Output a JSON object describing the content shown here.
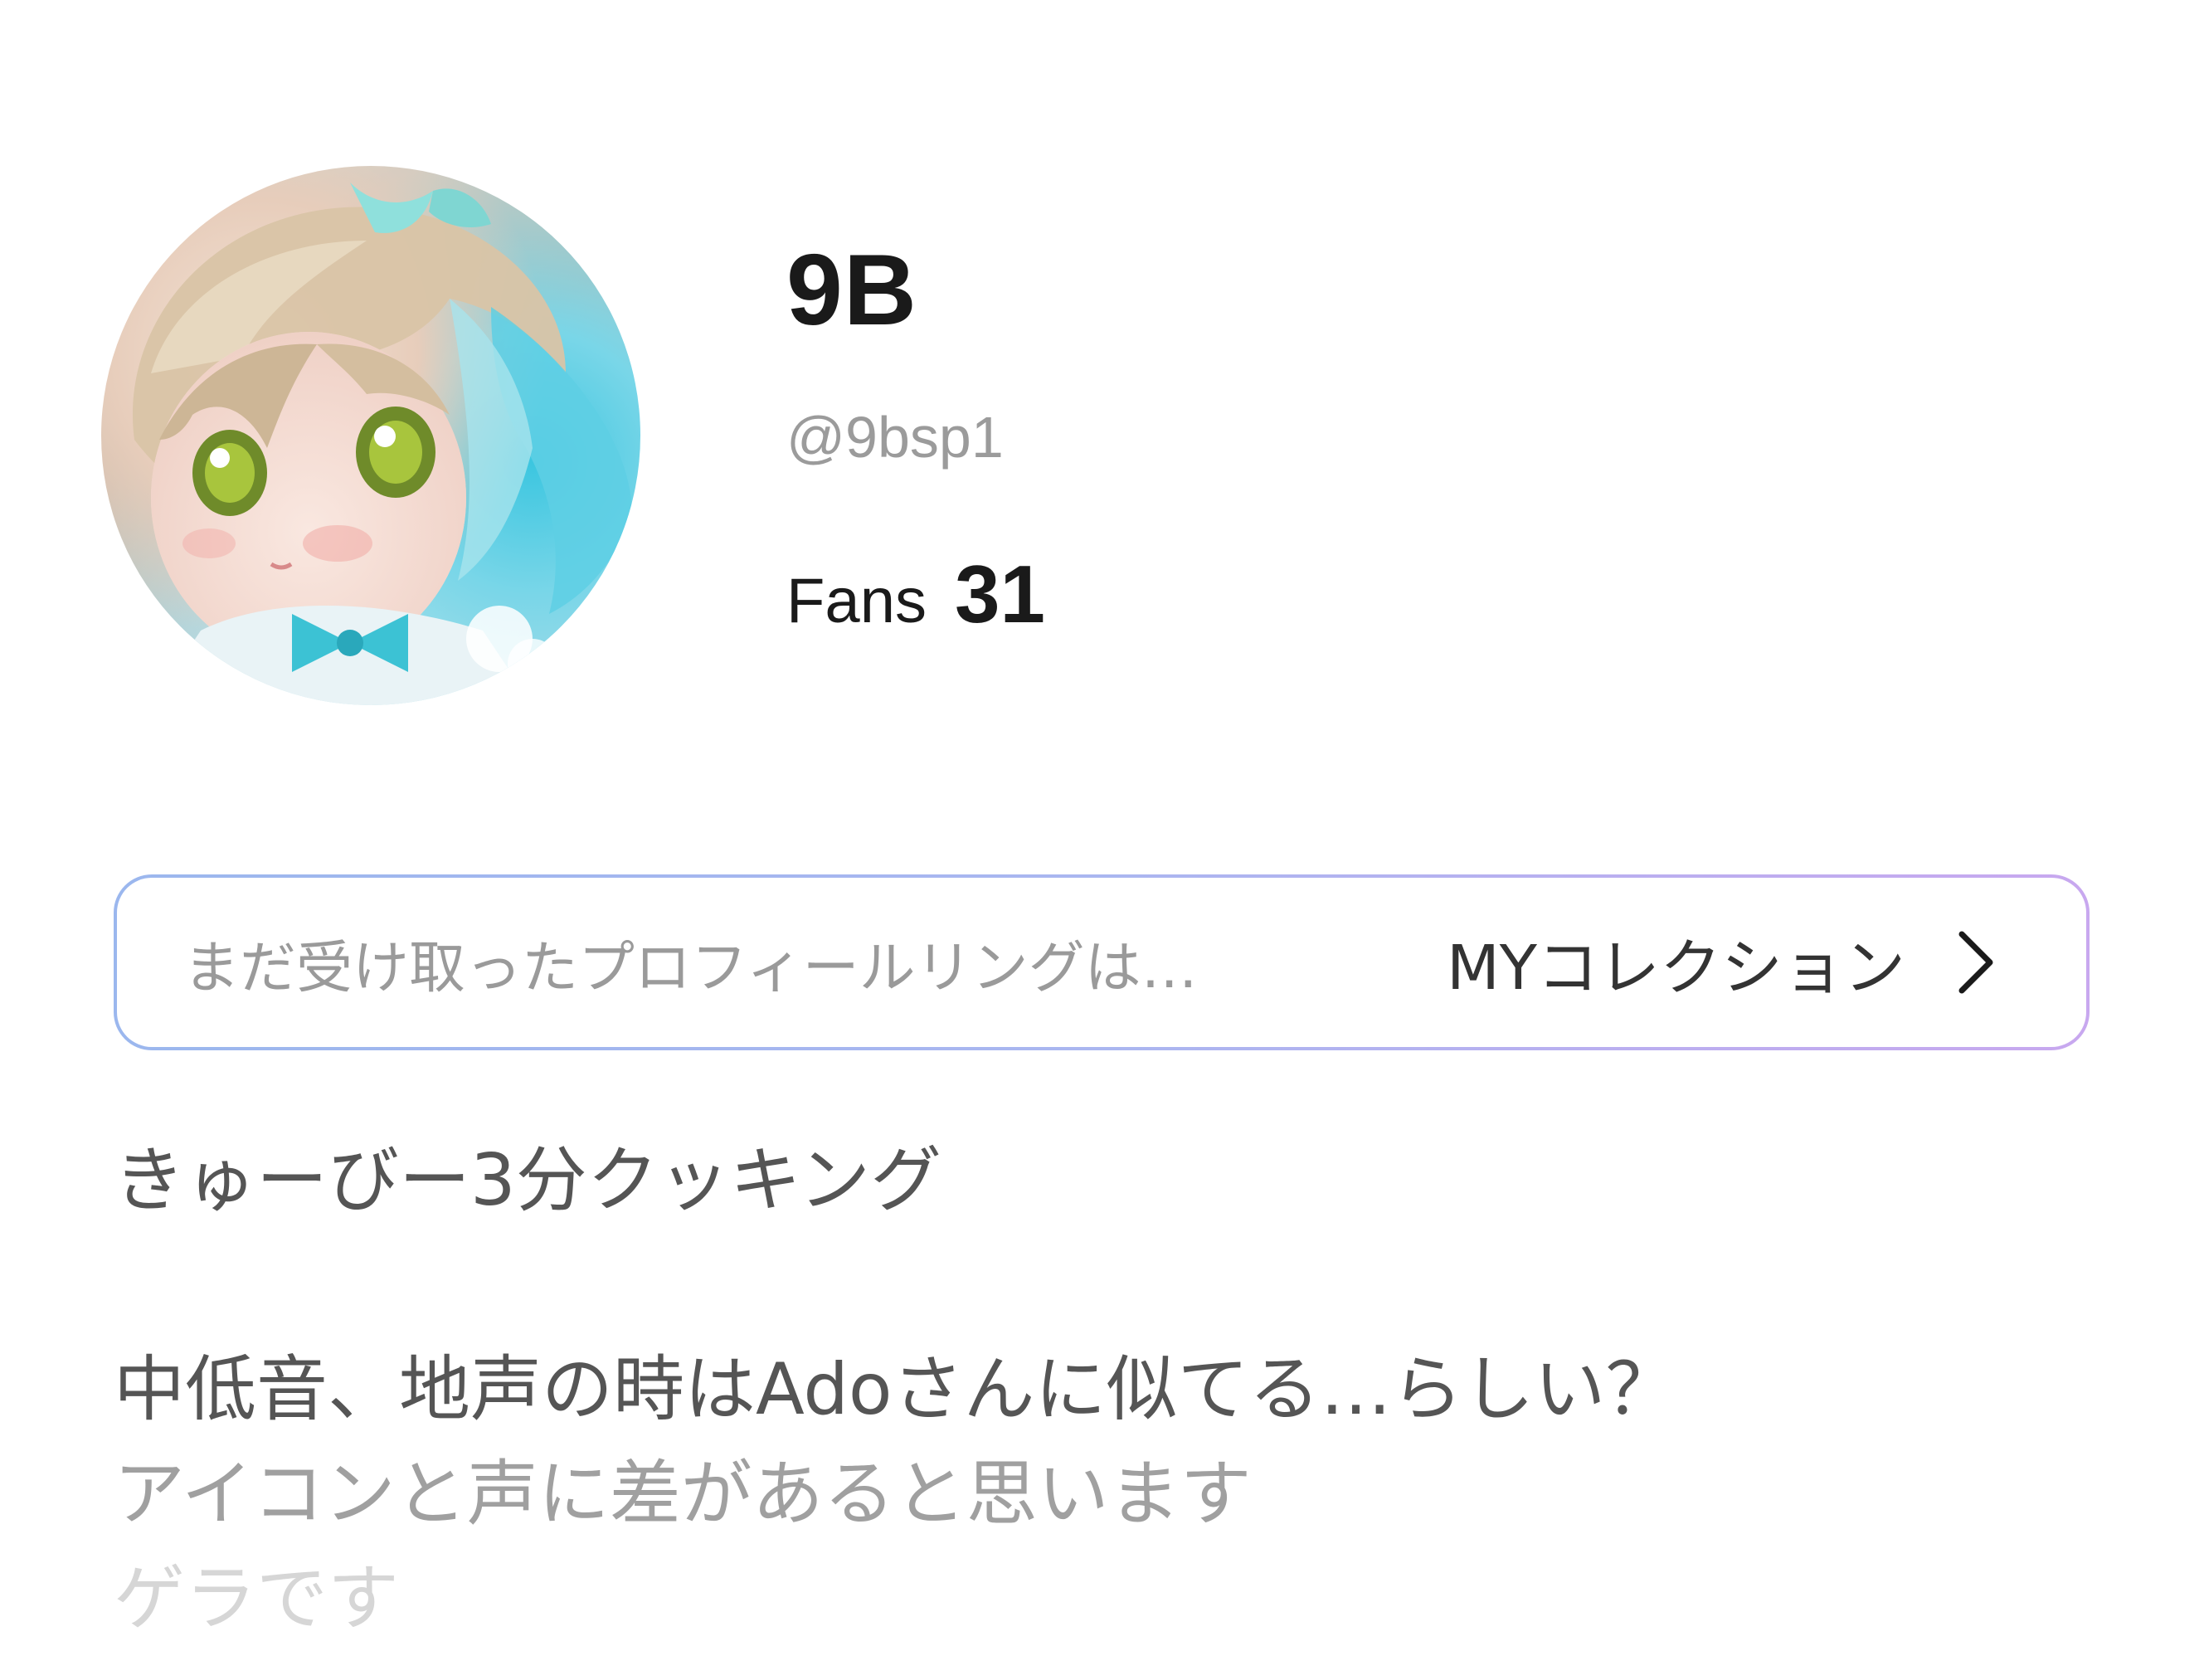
{
  "profile": {
    "display_name": "9B",
    "handle": "@9bsp1",
    "fans_label": "Fans",
    "fans_count": "31"
  },
  "avatar": {
    "icon": "avatar-image"
  },
  "ring_bar": {
    "placeholder_text": "まだ受け取ったプロフィールリングは…",
    "link_label": "MYコレクション",
    "icon": "chevron-right-icon",
    "border_colors": [
      "#9bb7ee",
      "#c8a8ef"
    ]
  },
  "bio": {
    "lines": [
      "きゅーびー3分クッキング",
      "",
      "中低音、地声の時はAdoさんに似てる…らしい？",
      "アイコンと声に差があると思います",
      "ゲラです"
    ],
    "colors": [
      "#555555",
      "#555555",
      "#555555",
      "#a0a0a0",
      "#d6d6d6"
    ]
  }
}
